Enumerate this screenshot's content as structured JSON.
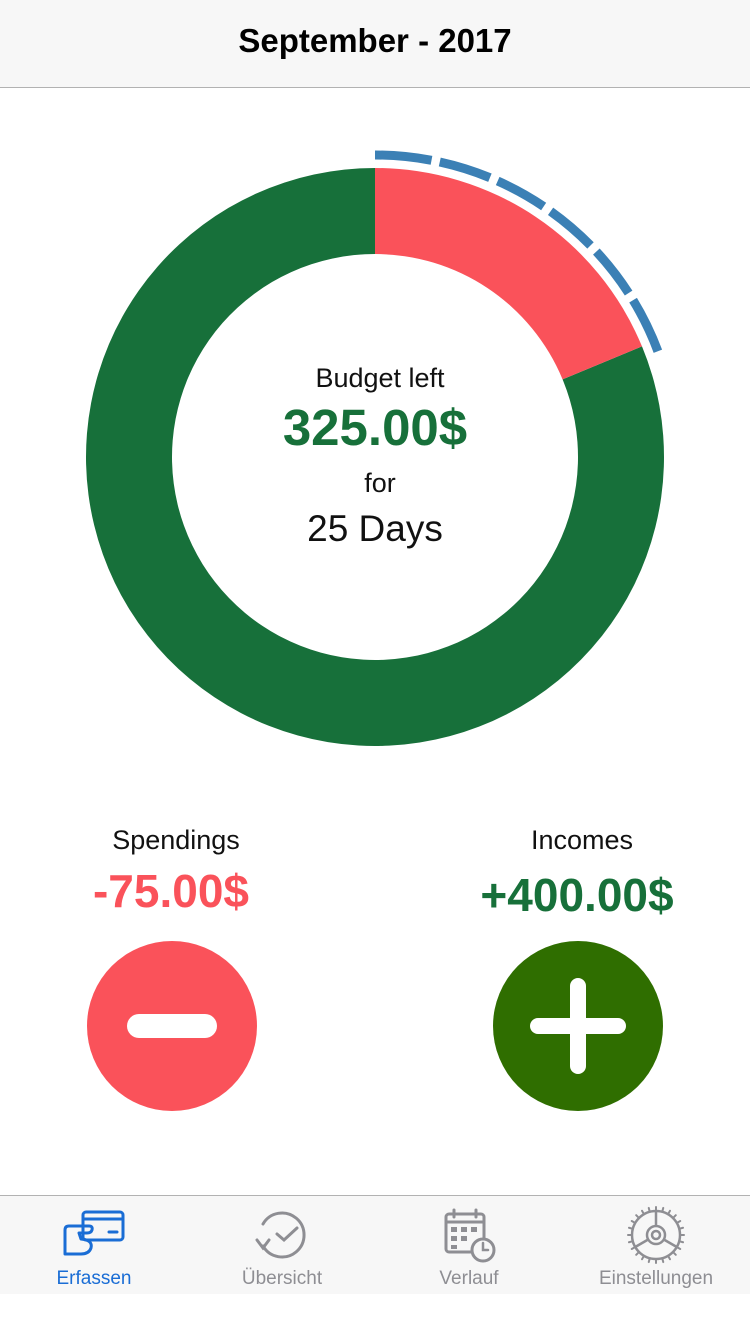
{
  "header": {
    "title": "September - 2017"
  },
  "budget": {
    "label": "Budget left",
    "value": "325.00$",
    "for_label": "for",
    "days": "25 Days",
    "spent_fraction": 0.1875,
    "remaining_fraction": 0.8125,
    "colors": {
      "remaining": "#17703a",
      "spent": "#fa525a",
      "time": "#3b80b5"
    }
  },
  "spendings": {
    "label": "Spendings",
    "amount": "-75.00$",
    "color": "#fa525a",
    "button_icon": "minus-icon"
  },
  "incomes": {
    "label": "Incomes",
    "amount": "+400.00$",
    "color": "#17703a",
    "button_color": "#2f6e00",
    "button_icon": "plus-icon"
  },
  "tabs": [
    {
      "label": "Erfassen",
      "icon": "credit-card-icon",
      "active": true
    },
    {
      "label": "Übersicht",
      "icon": "clock-history-icon",
      "active": false
    },
    {
      "label": "Verlauf",
      "icon": "calendar-clock-icon",
      "active": false
    },
    {
      "label": "Einstellungen",
      "icon": "gear-icon",
      "active": false
    }
  ]
}
